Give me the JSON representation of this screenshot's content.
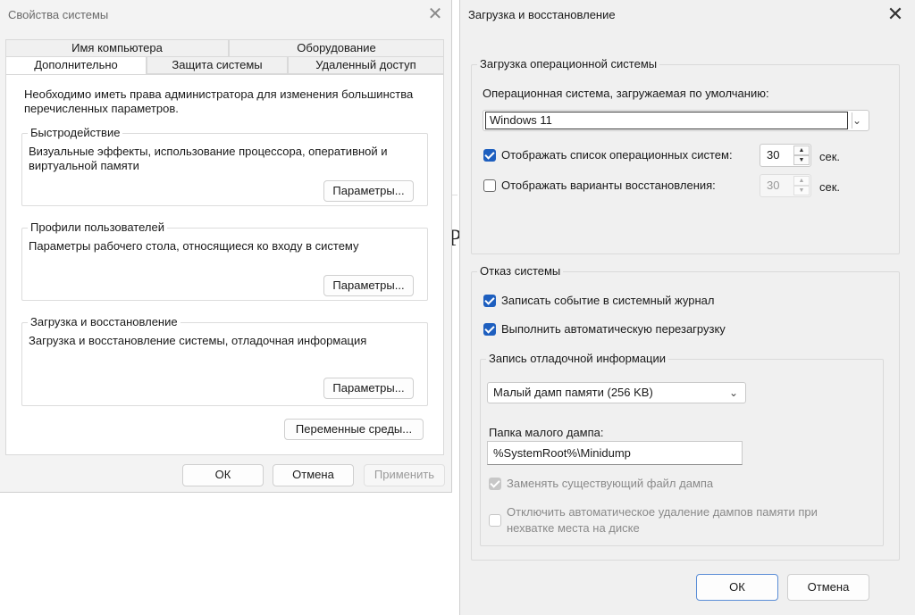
{
  "sysprops": {
    "title": "Свойства системы",
    "close_glyph": "✕",
    "tabs_row1": [
      "Имя компьютера",
      "Оборудование"
    ],
    "tabs_row2": [
      "Дополнительно",
      "Защита системы",
      "Удаленный доступ"
    ],
    "intro": "Необходимо иметь права администратора для изменения большинства перечисленных параметров.",
    "performance": {
      "legend": "Быстродействие",
      "desc": "Визуальные эффекты, использование процессора, оперативной и виртуальной памяти",
      "button": "Параметры..."
    },
    "profiles": {
      "legend": "Профили пользователей",
      "desc": "Параметры рабочего стола, относящиеся ко входу в систему",
      "button": "Параметры..."
    },
    "startup": {
      "legend": "Загрузка и восстановление",
      "desc": "Загрузка и восстановление системы, отладочная информация",
      "button": "Параметры..."
    },
    "env_button": "Переменные среды...",
    "ok": "ОК",
    "cancel": "Отмена",
    "apply": "Применить"
  },
  "recovery": {
    "title": "Загрузка и восстановление",
    "close_glyph": "✕",
    "os_section": {
      "legend": "Загрузка операционной системы",
      "default_os_label": "Операционная система, загружаемая по умолчанию:",
      "default_os_value": "Windows 11",
      "show_list": {
        "checked": true,
        "label": "Отображать список операционных систем:",
        "value": "30",
        "unit": "сек."
      },
      "show_recovery": {
        "checked": false,
        "label": "Отображать варианты восстановления:",
        "value": "30",
        "unit": "сек."
      }
    },
    "failure_section": {
      "legend": "Отказ системы",
      "write_event": {
        "checked": true,
        "label": "Записать событие в системный журнал"
      },
      "auto_restart": {
        "checked": true,
        "label": "Выполнить автоматическую перезагрузку"
      }
    },
    "debug_section": {
      "legend": "Запись отладочной информации",
      "dump_type": "Малый дамп памяти (256 KB)",
      "dump_dir_label": "Папка малого дампа:",
      "dump_dir_value": "%SystemRoot%\\Minidump",
      "overwrite": {
        "checked": true,
        "disabled": true,
        "label": "Заменять существующий файл дампа"
      },
      "disable_auto_delete": {
        "checked": false,
        "disabled": true,
        "label_line1": "Отключить автоматическое удаление дампов памяти при",
        "label_line2": "нехватке места на диске"
      }
    },
    "ok": "ОК",
    "cancel": "Отмена"
  },
  "icons": {
    "chevron": "chevron-down-icon",
    "spin_up": "▲",
    "spin_down": "▼",
    "chevron_glyph": "⌄"
  },
  "colors": {
    "accent": "#1e5fbf",
    "window_bg": "#f0f0f0"
  }
}
